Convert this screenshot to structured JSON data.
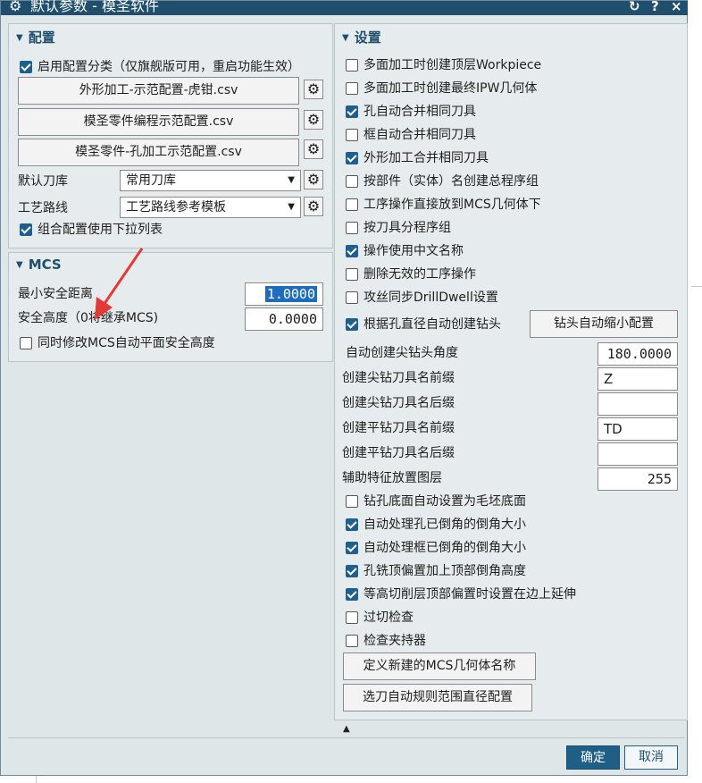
{
  "window": {
    "title": "默认参数 - 模圣软件",
    "controls": {
      "reset": "↻",
      "help": "?",
      "close": "×"
    }
  },
  "config": {
    "header": "配置",
    "enable_category": {
      "label": "启用配置分类（仅旗舰版可用，重启功能生效）",
      "checked": true
    },
    "files": [
      "外形加工-示范配置-虎钳.csv",
      "模圣零件编程示范配置.csv",
      "模圣零件-孔加工示范配置.csv"
    ],
    "tool_library": {
      "label": "默认刀库",
      "value": "常用刀库"
    },
    "process_route": {
      "label": "工艺路线",
      "value": "工艺路线参考模板"
    },
    "combo_dropdown": {
      "label": "组合配置使用下拉列表",
      "checked": true
    }
  },
  "mcs": {
    "header": "MCS",
    "min_safe_distance": {
      "label": "最小安全距离",
      "value": "1.0000"
    },
    "safe_height": {
      "label": "安全高度（0将继承MCS)",
      "value": "0.0000"
    },
    "modify_plane": {
      "label": "同时修改MCS自动平面安全高度",
      "checked": false
    }
  },
  "settings": {
    "header": "设置",
    "items": [
      {
        "label": "多面加工时创建顶层Workpiece",
        "checked": false
      },
      {
        "label": "多面加工时创建最终IPW几何体",
        "checked": false
      },
      {
        "label": "孔自动合并相同刀具",
        "checked": true
      },
      {
        "label": "框自动合并相同刀具",
        "checked": false
      },
      {
        "label": "外形加工合并相同刀具",
        "checked": true
      },
      {
        "label": "按部件（实体）名创建总程序组",
        "checked": false
      },
      {
        "label": "工序操作直接放到MCS几何体下",
        "checked": false
      },
      {
        "label": "按刀具分程序组",
        "checked": false
      },
      {
        "label": "操作使用中文名称",
        "checked": true
      },
      {
        "label": "删除无效的工序操作",
        "checked": false
      },
      {
        "label": "攻丝同步DrillDwell设置",
        "checked": false
      }
    ],
    "auto_drill": {
      "label": "根据孔直径自动创建钻头",
      "checked": true,
      "button": "钻头自动缩小配置"
    },
    "fields": [
      {
        "label": "自动创建尖钻头角度",
        "value": "180.0000",
        "align": "right"
      },
      {
        "label": "创建尖钻刀具名前缀",
        "value": "Z",
        "align": "left"
      },
      {
        "label": "创建尖钻刀具名后缀",
        "value": "",
        "align": "left"
      },
      {
        "label": "创建平钻刀具名前缀",
        "value": "TD",
        "align": "left"
      },
      {
        "label": "创建平钻刀具名后缀",
        "value": "",
        "align": "left"
      },
      {
        "label": "辅助特征放置图层",
        "value": "255",
        "align": "right"
      }
    ],
    "items2": [
      {
        "label": "钻孔底面自动设置为毛坯底面",
        "checked": false
      },
      {
        "label": "自动处理孔已倒角的倒角大小",
        "checked": true
      },
      {
        "label": "自动处理框已倒角的倒角大小",
        "checked": true
      },
      {
        "label": "孔铣顶偏置加上顶部倒角高度",
        "checked": true
      },
      {
        "label": "等高切削层顶部偏置时设置在边上延伸",
        "checked": true
      },
      {
        "label": "过切检查",
        "checked": false
      },
      {
        "label": "检查夹持器",
        "checked": false
      }
    ],
    "buttons": [
      "定义新建的MCS几何体名称",
      "选刀自动规则范围直径配置"
    ]
  },
  "footer": {
    "ok": "确定",
    "cancel": "取消"
  },
  "icons": {
    "gear": "gear-icon",
    "collapse": "triangle-down-icon",
    "annotation": "red-arrow-icon"
  },
  "colors": {
    "titlebar": "#1f4f6c",
    "accent": "#1e5f8c",
    "annotation": "#e53935"
  }
}
